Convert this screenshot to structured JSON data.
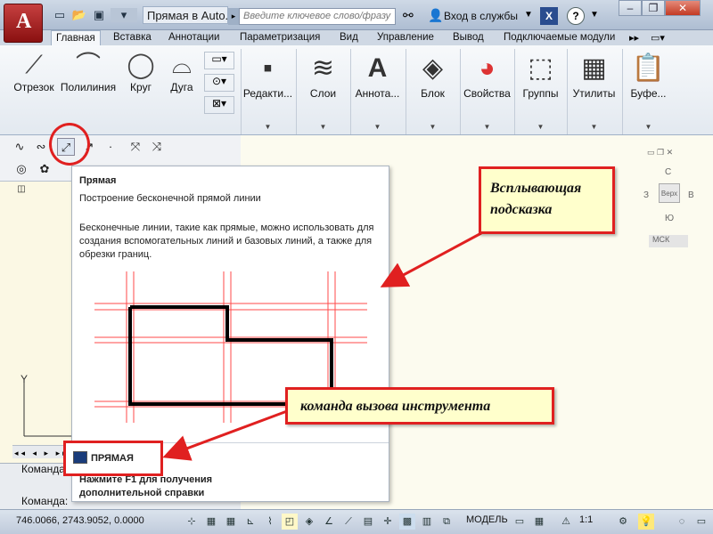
{
  "window": {
    "title": "Прямая в Auto...",
    "search_placeholder": "Введите ключевое слово/фразу",
    "signin": "Вход в службы",
    "help_label": "?",
    "app_letter": "A"
  },
  "tabs": [
    {
      "label": "Главная"
    },
    {
      "label": "Вставка"
    },
    {
      "label": "Аннотации"
    },
    {
      "label": "Параметризация"
    },
    {
      "label": "Вид"
    },
    {
      "label": "Управление"
    },
    {
      "label": "Вывод"
    },
    {
      "label": "Подключаемые модули"
    }
  ],
  "ribbon": {
    "draw": [
      {
        "label": "Отрезок"
      },
      {
        "label": "Полилиния"
      },
      {
        "label": "Круг"
      },
      {
        "label": "Дуга"
      }
    ],
    "panels": [
      {
        "label": "Редакти..."
      },
      {
        "label": "Слои"
      },
      {
        "label": "Аннота..."
      },
      {
        "label": "Блок"
      },
      {
        "label": "Свойства"
      },
      {
        "label": "Группы"
      },
      {
        "label": "Утилиты"
      },
      {
        "label": "Буфе..."
      }
    ]
  },
  "tooltip": {
    "title": "Прямая",
    "subtitle": "Построение бесконечной прямой линии",
    "description": "Бесконечные линии, такие как прямые, можно использовать для создания вспомогательных линий и базовых линий, а также для обрезки границ.",
    "command": "ПРЯМАЯ",
    "help": "Нажмите F1 для получения дополнительной справки"
  },
  "callouts": {
    "tooltip_note": "Всплывающая подсказка",
    "command_note": "команда вызова инструмента"
  },
  "viewcube": {
    "top_label": "С",
    "face_label": "Верх",
    "left_label": "З",
    "right_label": "В",
    "bottom_label": "Ю",
    "ucs_label": "МСК"
  },
  "ucs_axis": "Y",
  "command_line": [
    {
      "text": "Команда:"
    },
    {
      "text": "Команда:"
    }
  ],
  "status": {
    "coords": "746.0066, 2743.9052, 0.0000",
    "mode": "МОДЕЛЬ",
    "scale": "1:1"
  },
  "colors": {
    "accent": "#e02020",
    "canvas": "#fcfbef",
    "callout_bg": "#ffffcc"
  }
}
